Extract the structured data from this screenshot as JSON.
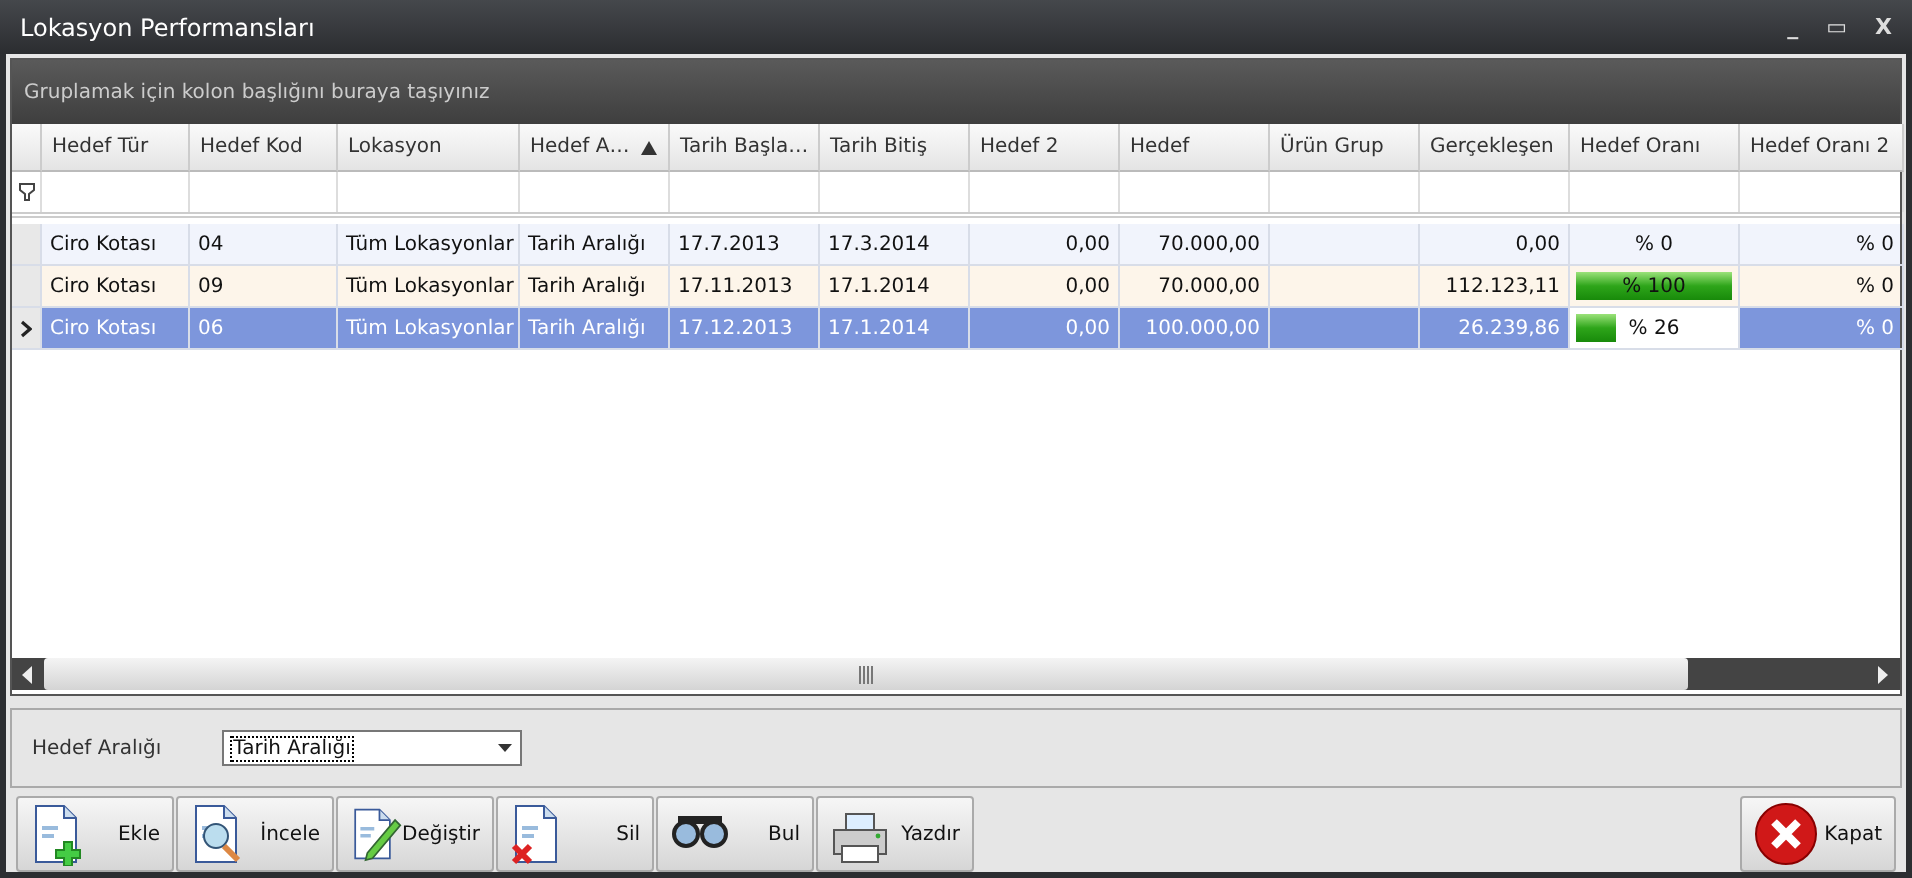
{
  "window": {
    "title": "Lokasyon Performansları",
    "controls": [
      "_",
      "▭",
      "X"
    ]
  },
  "group_panel": {
    "hint": "Gruplamak için kolon başlığını buraya taşıyınız"
  },
  "table": {
    "columns": [
      {
        "label": "Hedef Tür",
        "sorted": false
      },
      {
        "label": "Hedef Kod",
        "sorted": false
      },
      {
        "label": "Lokasyon",
        "sorted": false
      },
      {
        "label": "Hedef A…",
        "sorted": true
      },
      {
        "label": "Tarih Başla…",
        "sorted": false
      },
      {
        "label": "Tarih Bitiş",
        "sorted": false
      },
      {
        "label": "Hedef 2",
        "sorted": false
      },
      {
        "label": "Hedef",
        "sorted": false
      },
      {
        "label": "Ürün Grup",
        "sorted": false
      },
      {
        "label": "Gerçekleşen",
        "sorted": false
      },
      {
        "label": "Hedef Oranı",
        "sorted": false
      },
      {
        "label": "Hedef Oranı 2",
        "sorted": false
      }
    ],
    "rows": [
      {
        "selected": false,
        "cells": [
          "Ciro Kotası",
          "04",
          "Tüm Lokasyonlar",
          "Tarih Aralığı",
          "17.7.2013",
          "17.3.2014",
          "0,00",
          "70.000,00",
          "",
          "0,00"
        ],
        "rate": {
          "text": "% 0",
          "level": 0
        },
        "rate2": "% 0"
      },
      {
        "selected": false,
        "cells": [
          "Ciro Kotası",
          "09",
          "Tüm Lokasyonlar",
          "Tarih Aralığı",
          "17.11.2013",
          "17.1.2014",
          "0,00",
          "70.000,00",
          "",
          "112.123,11"
        ],
        "rate": {
          "text": "% 100",
          "level": 1
        },
        "rate2": "% 0"
      },
      {
        "selected": true,
        "cells": [
          "Ciro Kotası",
          "06",
          "Tüm Lokasyonlar",
          "Tarih Aralığı",
          "17.12.2013",
          "17.1.2014",
          "0,00",
          "100.000,00",
          "",
          "26.239,86"
        ],
        "rate": {
          "text": "% 26",
          "level": 0.26
        },
        "rate2": "% 0"
      }
    ]
  },
  "filter": {
    "label": "Hedef Aralığı",
    "value": "Tarih Aralığı"
  },
  "buttons": [
    {
      "label": "Ekle",
      "kind": "add"
    },
    {
      "label": "İncele",
      "kind": "inspect"
    },
    {
      "label": "Değiştir",
      "kind": "edit"
    },
    {
      "label": "Sil",
      "kind": "delete"
    },
    {
      "label": "Bul",
      "kind": "find"
    },
    {
      "label": "Yazdır",
      "kind": "print"
    }
  ],
  "close_button": {
    "label": "Kapat"
  }
}
